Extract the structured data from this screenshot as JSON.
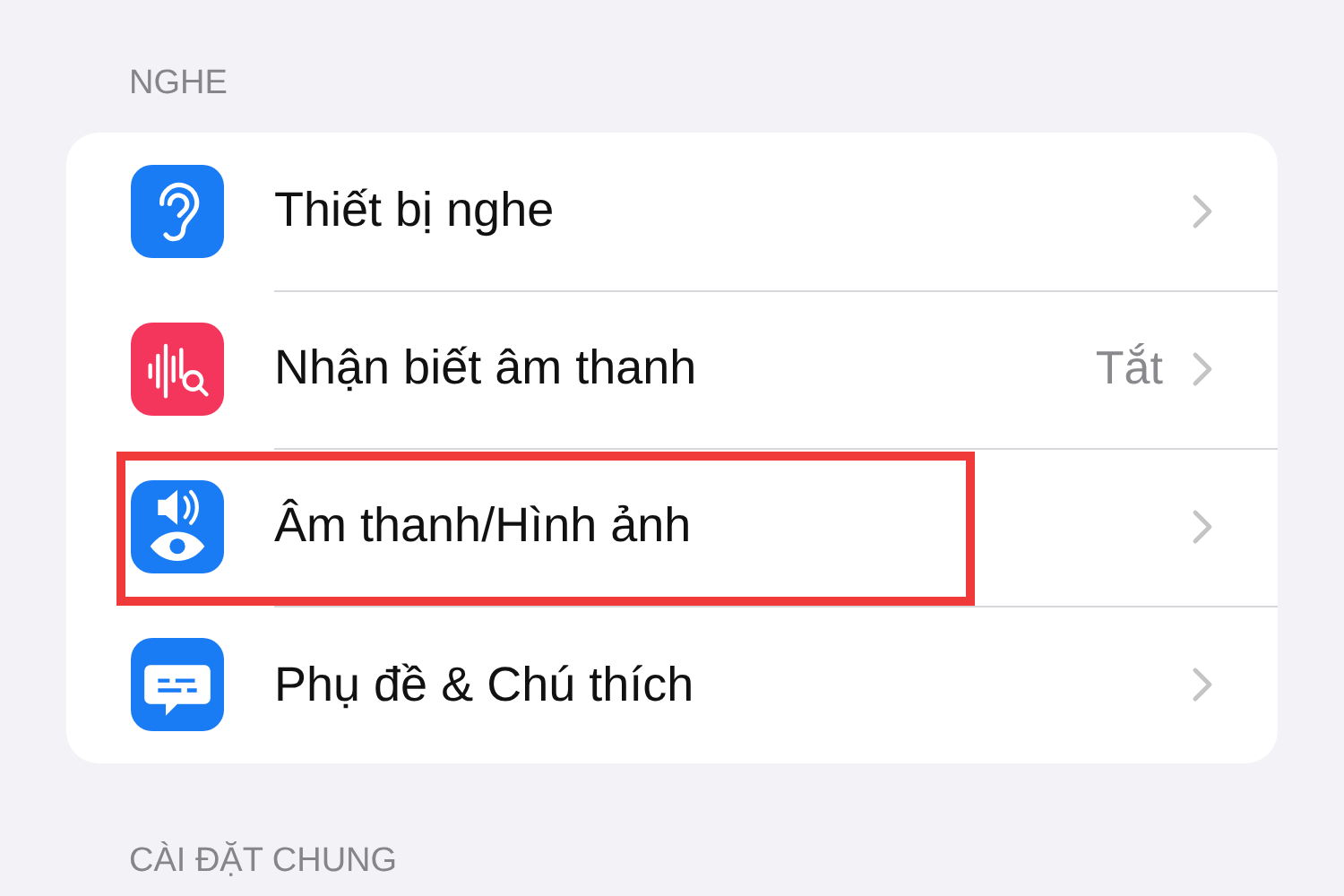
{
  "section_title": "NGHE",
  "rows": [
    {
      "kind": "ear",
      "color": "#1a7cf5",
      "label": "Thiết bị nghe",
      "highlighted": false
    },
    {
      "kind": "sound-search",
      "color": "#f5365c",
      "label": "Nhận biết âm thanh",
      "value": "Tắt",
      "highlighted": false
    },
    {
      "kind": "speaker-eye",
      "color": "#1a7cf5",
      "label": "Âm thanh/Hình ảnh",
      "highlighted": true
    },
    {
      "kind": "caption",
      "color": "#1a7cf5",
      "label": "Phụ đề & Chú thích",
      "highlighted": false
    }
  ],
  "next_section_title": "CÀI ĐẶT CHUNG"
}
